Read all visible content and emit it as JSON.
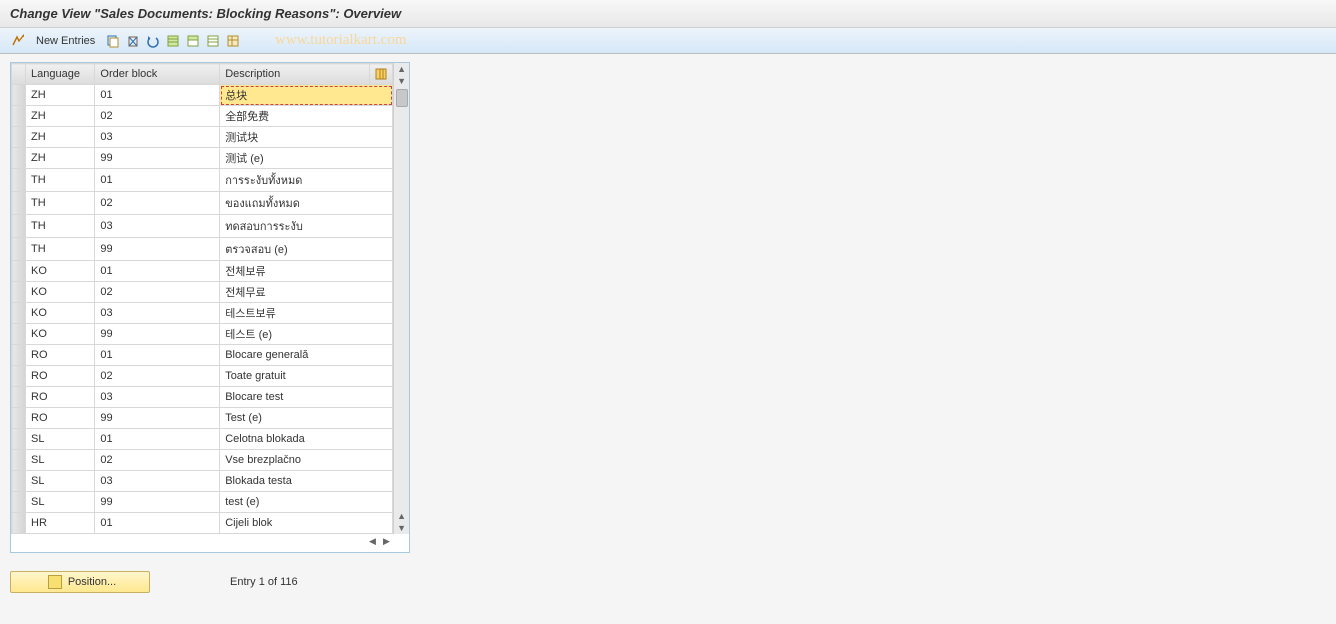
{
  "header": {
    "title": "Change View \"Sales Documents: Blocking Reasons\": Overview"
  },
  "toolbar": {
    "new_entries_label": "New Entries",
    "watermark": "www.tutorialkart.com"
  },
  "table": {
    "columns": {
      "language": "Language",
      "order_block": "Order block",
      "description": "Description"
    },
    "rows": [
      {
        "lang": "ZH",
        "order": "01",
        "desc": "总块",
        "selected": true
      },
      {
        "lang": "ZH",
        "order": "02",
        "desc": "全部免费"
      },
      {
        "lang": "ZH",
        "order": "03",
        "desc": "测试块"
      },
      {
        "lang": "ZH",
        "order": "99",
        "desc": "测试 (e)"
      },
      {
        "lang": "TH",
        "order": "01",
        "desc": "การระงับทั้งหมด"
      },
      {
        "lang": "TH",
        "order": "02",
        "desc": "ของแถมทั้งหมด"
      },
      {
        "lang": "TH",
        "order": "03",
        "desc": "ทดสอบการระงับ"
      },
      {
        "lang": "TH",
        "order": "99",
        "desc": "ตรวจสอบ (e)"
      },
      {
        "lang": "KO",
        "order": "01",
        "desc": "전체보류"
      },
      {
        "lang": "KO",
        "order": "02",
        "desc": "전체무료"
      },
      {
        "lang": "KO",
        "order": "03",
        "desc": "테스트보류"
      },
      {
        "lang": "KO",
        "order": "99",
        "desc": "테스트 (e)"
      },
      {
        "lang": "RO",
        "order": "01",
        "desc": "Blocare generală"
      },
      {
        "lang": "RO",
        "order": "02",
        "desc": "Toate gratuit"
      },
      {
        "lang": "RO",
        "order": "03",
        "desc": "Blocare test"
      },
      {
        "lang": "RO",
        "order": "99",
        "desc": "Test (e)"
      },
      {
        "lang": "SL",
        "order": "01",
        "desc": "Celotna blokada"
      },
      {
        "lang": "SL",
        "order": "02",
        "desc": "Vse brezplačno"
      },
      {
        "lang": "SL",
        "order": "03",
        "desc": "Blokada testa"
      },
      {
        "lang": "SL",
        "order": "99",
        "desc": "test (e)"
      },
      {
        "lang": "HR",
        "order": "01",
        "desc": "Cijeli blok"
      }
    ]
  },
  "footer": {
    "position_label": "Position...",
    "entry_text": "Entry 1 of 116"
  }
}
